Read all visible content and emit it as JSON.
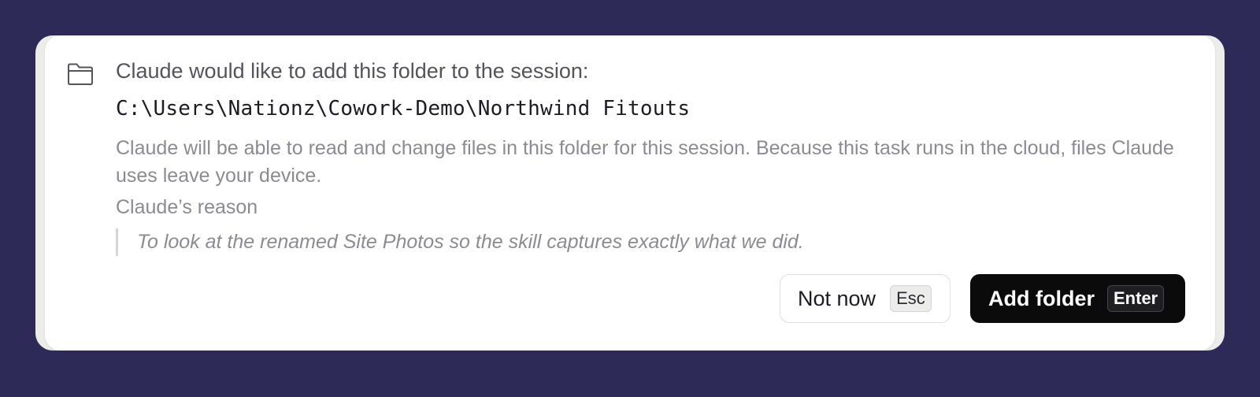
{
  "dialog": {
    "icon": "folder-icon",
    "headline": "Claude would like to add this folder to the session:",
    "path": "C:\\Users\\Nationz\\Cowork-Demo\\Northwind Fitouts",
    "description": "Claude will be able to read and change files in this folder for this session. Because this task runs in the cloud, files Claude uses leave your device.",
    "reason_label": "Claude’s reason",
    "reason_text": "To look at the renamed Site Photos so the skill captures exactly what we did."
  },
  "actions": {
    "not_now_label": "Not now",
    "not_now_shortcut": "Esc",
    "add_folder_label": "Add folder",
    "add_folder_shortcut": "Enter"
  },
  "colors": {
    "background": "#2e2a57",
    "primary_button": "#0b0b0c",
    "card": "#ffffff"
  }
}
